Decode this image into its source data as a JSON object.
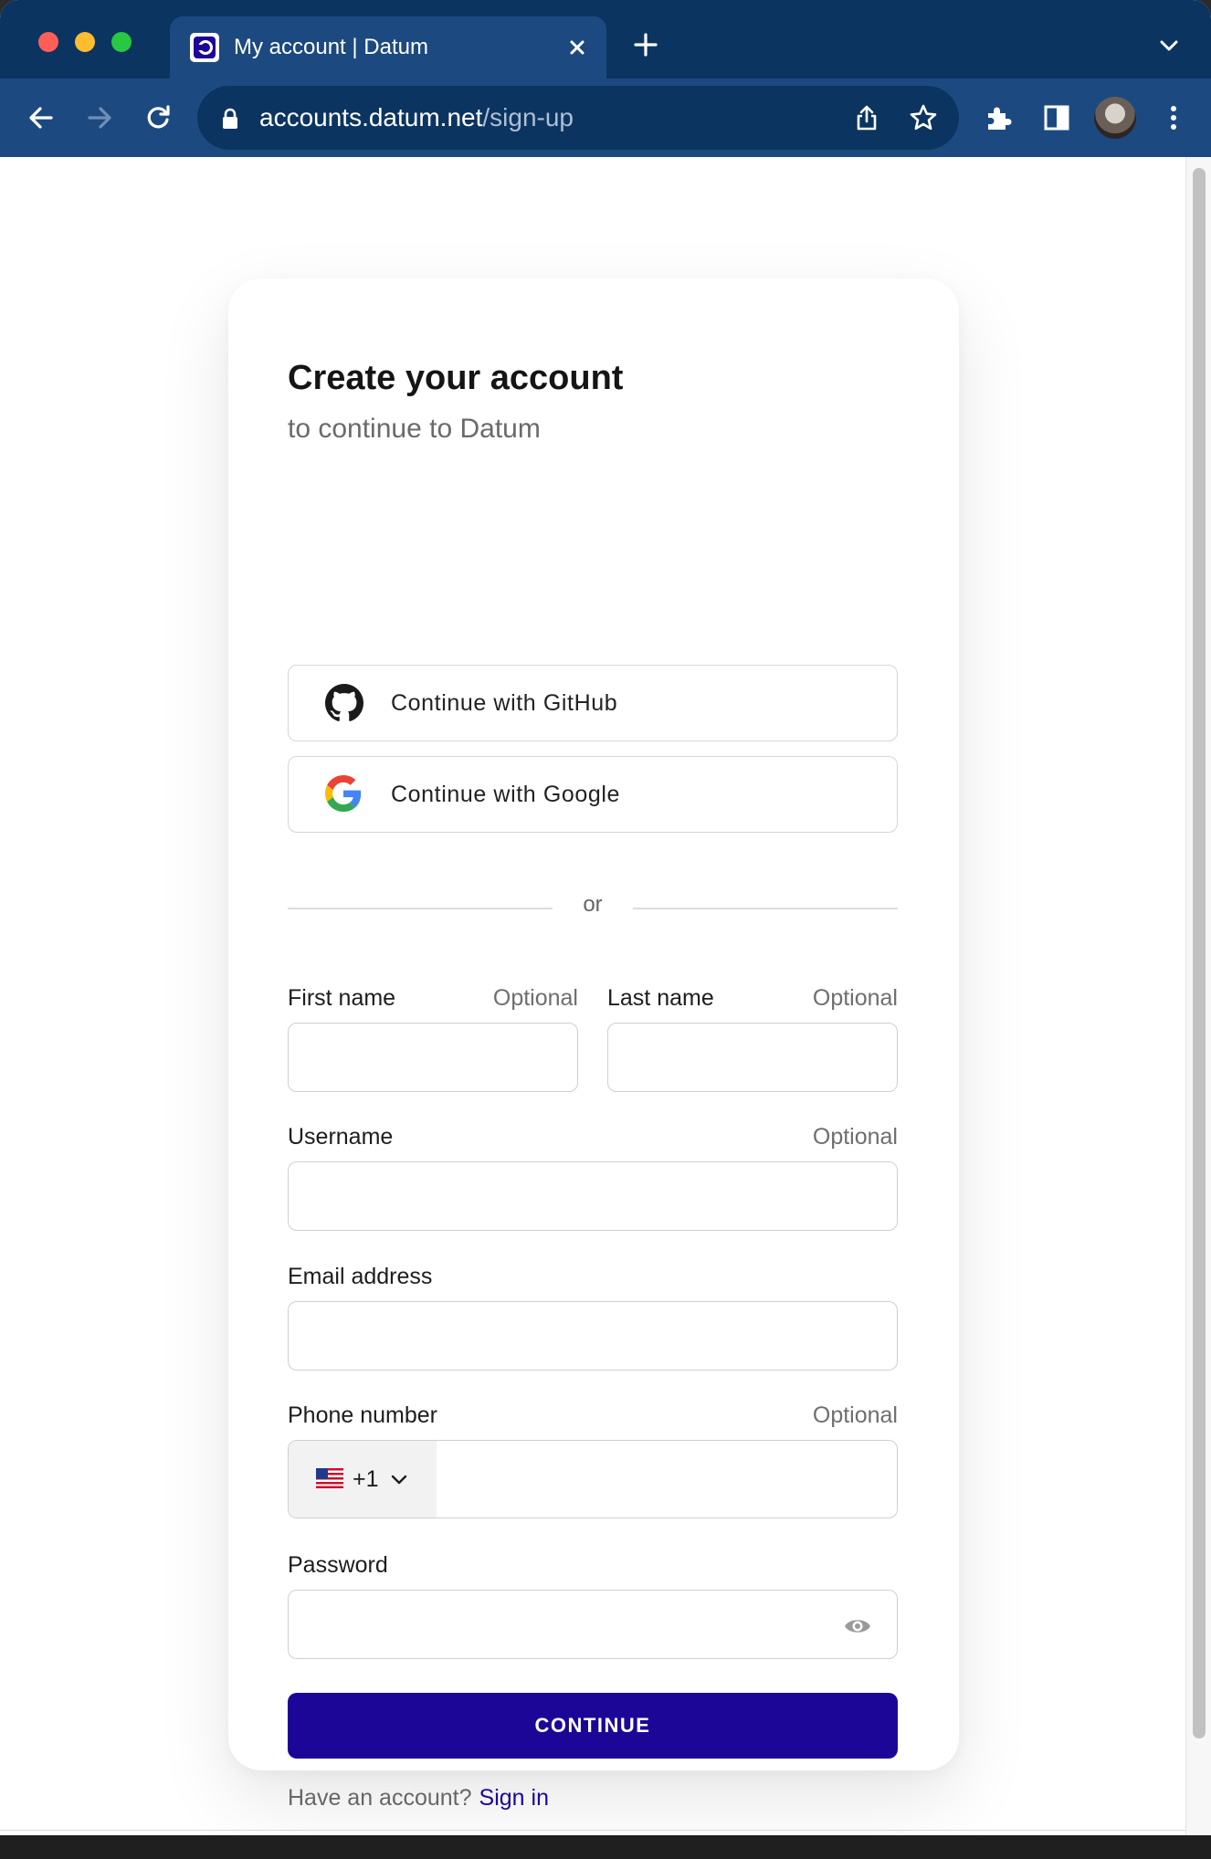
{
  "browser": {
    "tab_title": "My account | Datum",
    "url_host": "accounts.datum.net",
    "url_path": "/sign-up"
  },
  "form": {
    "title": "Create your account",
    "subtitle": "to continue to Datum",
    "github_label": "Continue with GitHub",
    "google_label": "Continue with Google",
    "divider_text": "or",
    "first_name_label": "First name",
    "last_name_label": "Last name",
    "username_label": "Username",
    "email_label": "Email address",
    "phone_label": "Phone number",
    "password_label": "Password",
    "optional_text": "Optional",
    "country_code": "+1",
    "country_flag": "us-flag",
    "continue_label": "CONTINUE",
    "have_account_text": "Have an account?",
    "sign_in_label": "Sign in"
  },
  "colors": {
    "chrome_dark": "#0c3460",
    "chrome_toolbar": "#1c4a80",
    "primary_button": "#1c0698",
    "link": "#1c0698"
  },
  "icons": [
    "back-arrow-icon",
    "forward-arrow-icon",
    "reload-icon",
    "lock-icon",
    "share-icon",
    "star-icon",
    "puzzle-icon",
    "sidebar-icon",
    "kebab-menu-icon",
    "github-icon",
    "google-icon",
    "eye-icon",
    "chevron-down-icon"
  ]
}
